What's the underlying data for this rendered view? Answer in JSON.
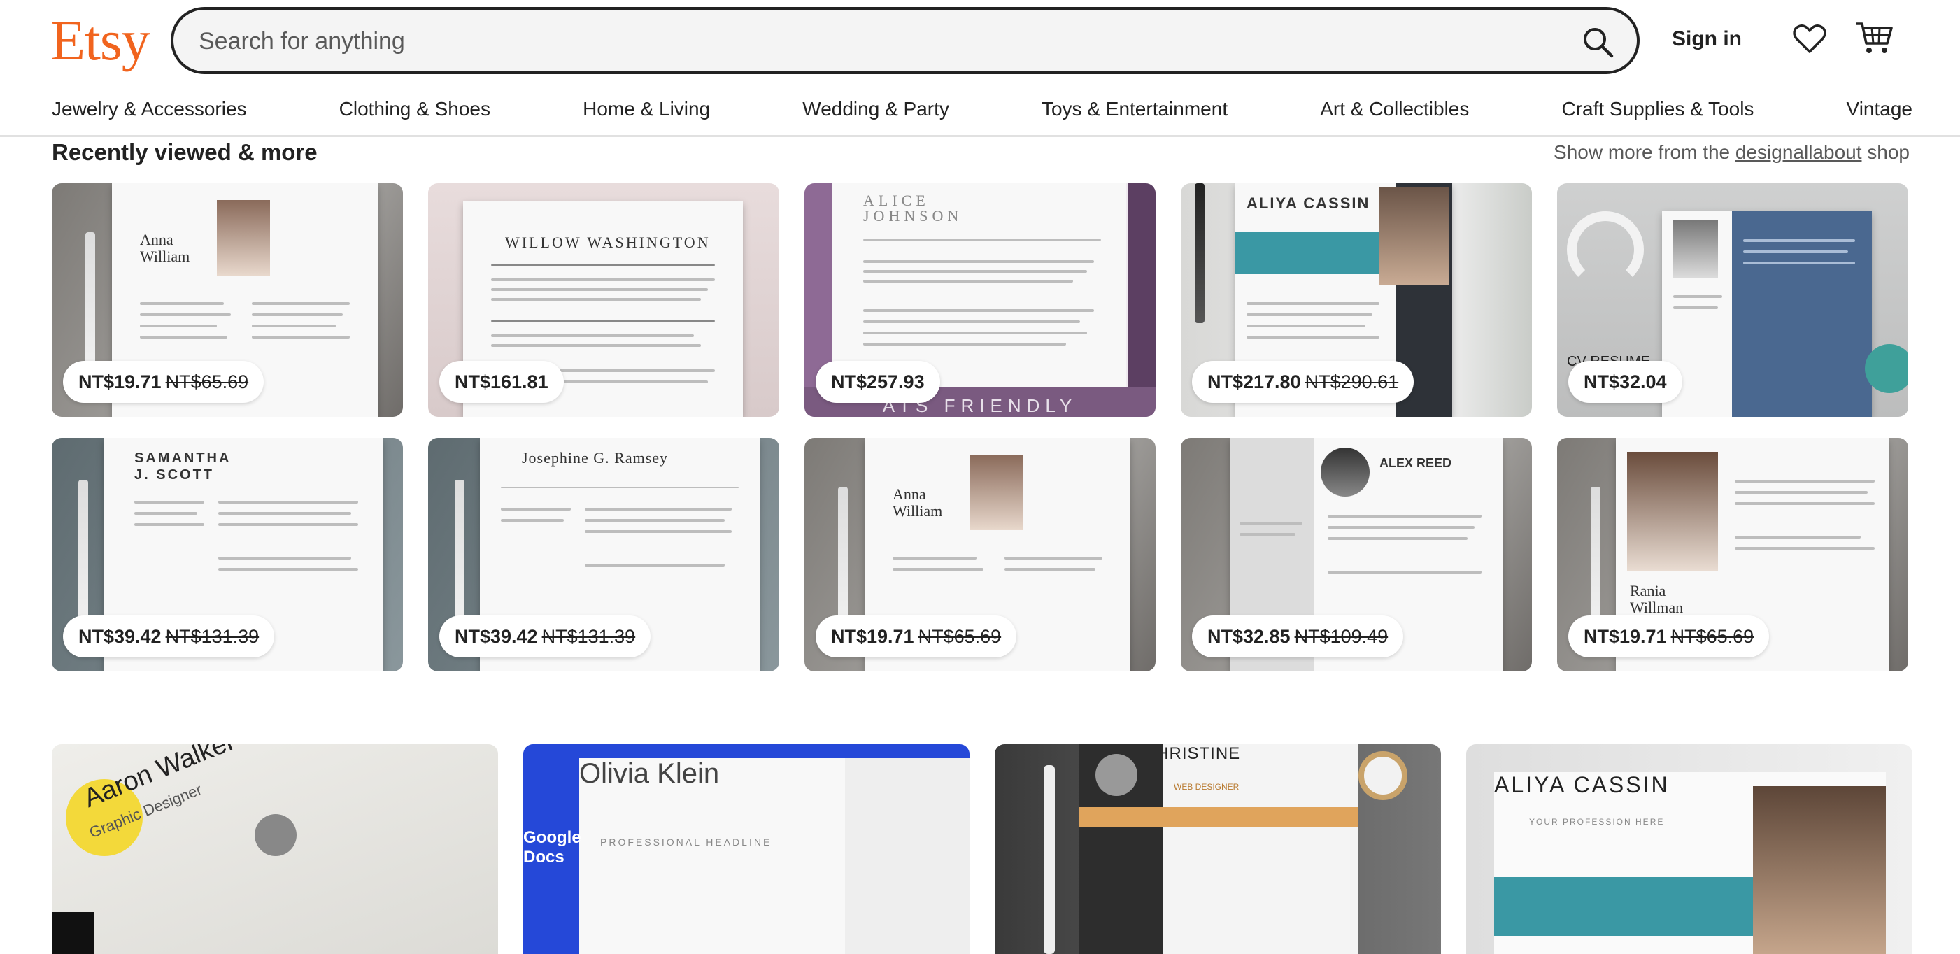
{
  "header": {
    "logo": "Etsy",
    "search_placeholder": "Search for anything",
    "signin_label": "Sign in",
    "icons": {
      "search": "search-icon",
      "favorites": "heart-icon",
      "cart": "cart-icon"
    },
    "brand_color": "#F1641E"
  },
  "nav": {
    "items": [
      "Jewelry & Accessories",
      "Clothing & Shoes",
      "Home & Living",
      "Wedding & Party",
      "Toys & Entertainment",
      "Art & Collectibles",
      "Craft Supplies & Tools",
      "Vintage"
    ]
  },
  "recently_viewed": {
    "title": "Recently viewed & more",
    "more_prefix": "Show more from the",
    "shop_name": "designallabout",
    "more_suffix": "shop",
    "items": [
      {
        "price": "NT$19.71",
        "original": "NT$65.69",
        "name": "Anna",
        "name2": "William"
      },
      {
        "price": "NT$161.81",
        "original": "",
        "name": "WILLOW WASHINGTON",
        "name2": ""
      },
      {
        "price": "NT$257.93",
        "original": "",
        "name": "ALICE",
        "name2": "JOHNSON",
        "banner": "ATS FRIENDLY"
      },
      {
        "price": "NT$217.80",
        "original": "NT$290.61",
        "name": "ALIYA CASSIN",
        "name2": ""
      },
      {
        "price": "NT$32.04",
        "original": "",
        "name": "CV RESUME",
        "name2": ""
      },
      {
        "price": "NT$39.42",
        "original": "NT$131.39",
        "name": "SAMANTHA",
        "name2": "J. SCOTT"
      },
      {
        "price": "NT$39.42",
        "original": "NT$131.39",
        "name": "Josephine G. Ramsey",
        "name2": ""
      },
      {
        "price": "NT$19.71",
        "original": "NT$65.69",
        "name": "Anna",
        "name2": "William"
      },
      {
        "price": "NT$32.85",
        "original": "NT$109.49",
        "name": "ALEX REED",
        "name2": ""
      },
      {
        "price": "NT$19.71",
        "original": "NT$65.69",
        "name": "Rania",
        "name2": "Willman"
      }
    ]
  },
  "more_listings": [
    {
      "name": "Aaron Walker",
      "subtitle": "Graphic Designer"
    },
    {
      "name": "Olivia Klein",
      "subtitle": "PROFESSIONAL HEADLINE",
      "side": "Google Docs"
    },
    {
      "name": "BAILLY CHRISTINE",
      "subtitle": "WEB DESIGNER"
    },
    {
      "name": "ALIYA CASSIN",
      "subtitle": "YOUR PROFESSION HERE"
    }
  ]
}
